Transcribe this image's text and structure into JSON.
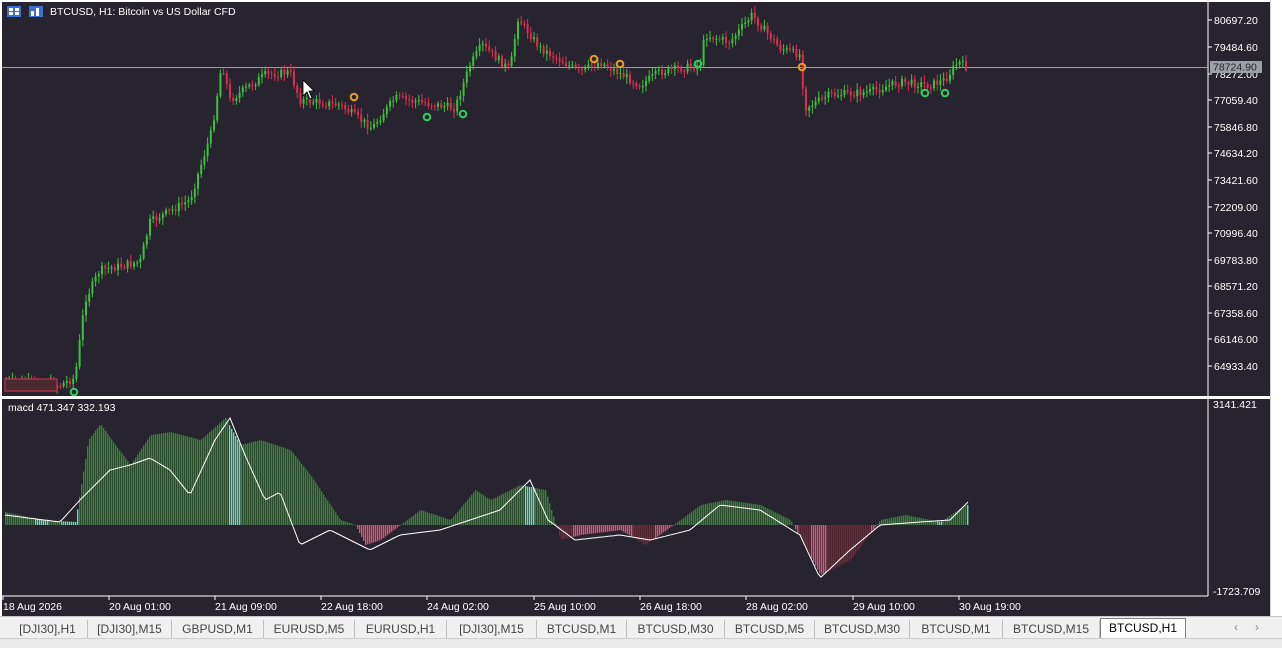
{
  "chart": {
    "symbol_title": "BTCUSD, H1:  Bitcoin vs US Dollar CFD",
    "current_price_label": "78724.90",
    "price_scale": [
      "80697.20",
      "79484.60",
      "78272.00",
      "77059.40",
      "75846.80",
      "74634.20",
      "73421.60",
      "72209.00",
      "70996.40",
      "69783.80",
      "68571.20",
      "67358.60",
      "66146.00",
      "64933.40"
    ],
    "ask_tag": "",
    "time_labels": [
      "18 Aug 2026",
      "20 Aug 01:00",
      "21 Aug 09:00",
      "22 Aug 18:00",
      "24 Aug 02:00",
      "25 Aug 10:00",
      "26 Aug 18:00",
      "28 Aug 02:00",
      "29 Aug 10:00",
      "30 Aug 19:00"
    ],
    "colors": {
      "background": "#27242f",
      "bull": "#3fbf3f",
      "bear": "#d9304f",
      "grid_line": "#9aa0a6",
      "text": "#ffffff",
      "signal_up": "#2fcf5f",
      "signal_down": "#e8a020"
    }
  },
  "indicator": {
    "label": "macd  471.347 332.193",
    "scale_top": "3141.421",
    "scale_bottom": "-1723.709"
  },
  "tabs": [
    {
      "label": "[DJI30],H1",
      "active": false
    },
    {
      "label": "[DJI30],M15",
      "active": false
    },
    {
      "label": "GBPUSD,M1",
      "active": false
    },
    {
      "label": "EURUSD,M5",
      "active": false
    },
    {
      "label": "EURUSD,H1",
      "active": false
    },
    {
      "label": "[DJI30],M15",
      "active": false
    },
    {
      "label": "BTCUSD,M1",
      "active": false
    },
    {
      "label": "BTCUSD,M30",
      "active": false
    },
    {
      "label": "BTCUSD,M5",
      "active": false
    },
    {
      "label": "BTCUSD,M30",
      "active": false
    },
    {
      "label": "BTCUSD,M1",
      "active": false
    },
    {
      "label": "BTCUSD,M15",
      "active": false
    },
    {
      "label": "BTCUSD,H1",
      "active": true
    }
  ],
  "nav": {
    "left": "‹",
    "right": "›"
  }
}
